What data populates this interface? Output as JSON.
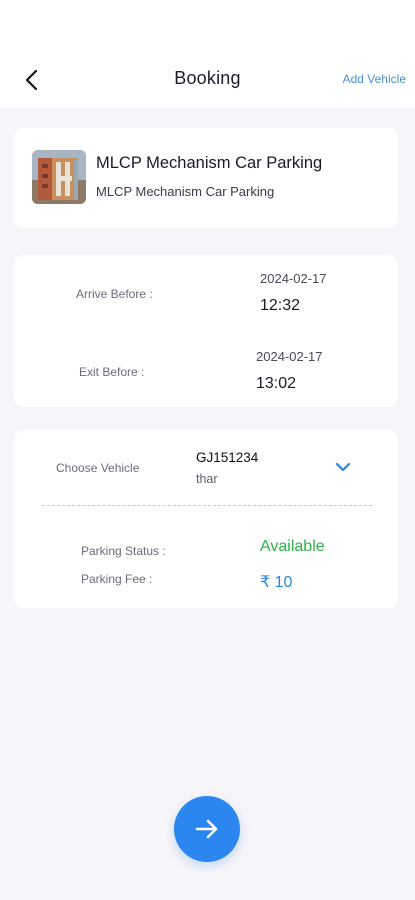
{
  "header": {
    "title": "Booking",
    "add_vehicle_label": "Add Vehicle",
    "back_icon": "chevron-left-icon"
  },
  "parking": {
    "name": "MLCP Mechanism Car Parking",
    "subtitle": "MLCP Mechanism Car Parking"
  },
  "times": {
    "arrive_label": "Arrive Before :",
    "arrive_date": "2024-02-17",
    "arrive_time": "12:32",
    "exit_label": "Exit Before :",
    "exit_date": "2024-02-17",
    "exit_time": "13:02"
  },
  "vehicle": {
    "label": "Choose Vehicle",
    "number": "GJ151234",
    "model": "thar",
    "dropdown_icon": "chevron-down-icon"
  },
  "summary": {
    "status_label": "Parking Status :",
    "status_value": "Available",
    "fee_label": "Parking Fee :",
    "fee_value": "₹ 10"
  },
  "colors": {
    "accent": "#2c86ef",
    "available": "#2fb04a",
    "fee": "#2a86d8",
    "link": "#4a8fd8"
  },
  "fab": {
    "icon": "arrow-right-icon"
  }
}
